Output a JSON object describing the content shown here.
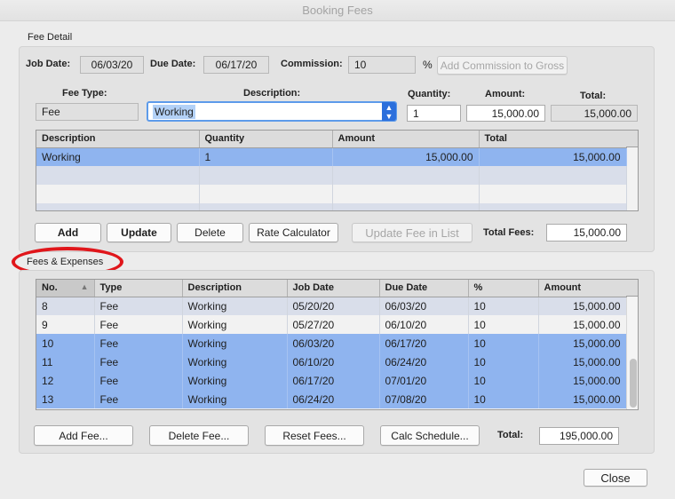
{
  "window": {
    "title": "Booking Fees"
  },
  "fee_detail": {
    "section_label": "Fee Detail",
    "job_date": {
      "label": "Job Date:",
      "value": "06/03/20"
    },
    "due_date": {
      "label": "Due Date:",
      "value": "06/17/20"
    },
    "commission": {
      "label": "Commission:",
      "value": "10",
      "unit": "%"
    },
    "add_commission_button": "Add Commission to Gross",
    "fee_type": {
      "label": "Fee Type:",
      "value": "Fee"
    },
    "description": {
      "label": "Description:",
      "value": "Working"
    },
    "quantity": {
      "label": "Quantity:",
      "value": "1"
    },
    "amount": {
      "label": "Amount:",
      "value": "15,000.00"
    },
    "total": {
      "label": "Total:",
      "value": "15,000.00"
    },
    "table": {
      "columns": [
        "Description",
        "Quantity",
        "Amount",
        "Total"
      ],
      "rows": [
        [
          "Working",
          "1",
          "15,000.00",
          "15,000.00"
        ]
      ]
    },
    "buttons": {
      "add": "Add",
      "update": "Update",
      "delete": "Delete",
      "rate_calculator": "Rate Calculator",
      "update_fee_in_list": "Update Fee in List"
    },
    "total_fees": {
      "label": "Total Fees:",
      "value": "15,000.00"
    }
  },
  "fees_expenses": {
    "section_label": "Fees & Expenses",
    "table": {
      "columns": [
        "No.",
        "Type",
        "Description",
        "Job Date",
        "Due Date",
        "%",
        "Amount"
      ],
      "sort_indicator": "▲",
      "rows": [
        [
          "8",
          "Fee",
          "Working",
          "05/20/20",
          "06/03/20",
          "10",
          "15,000.00"
        ],
        [
          "9",
          "Fee",
          "Working",
          "05/27/20",
          "06/10/20",
          "10",
          "15,000.00"
        ],
        [
          "10",
          "Fee",
          "Working",
          "06/03/20",
          "06/17/20",
          "10",
          "15,000.00"
        ],
        [
          "11",
          "Fee",
          "Working",
          "06/10/20",
          "06/24/20",
          "10",
          "15,000.00"
        ],
        [
          "12",
          "Fee",
          "Working",
          "06/17/20",
          "07/01/20",
          "10",
          "15,000.00"
        ],
        [
          "13",
          "Fee",
          "Working",
          "06/24/20",
          "07/08/20",
          "10",
          "15,000.00"
        ]
      ]
    },
    "buttons": {
      "add_fee": "Add Fee...",
      "delete_fee": "Delete Fee...",
      "reset_fees": "Reset Fees...",
      "calc_schedule": "Calc Schedule..."
    },
    "total": {
      "label": "Total:",
      "value": "195,000.00"
    }
  },
  "close_button": "Close",
  "colors": {
    "selection": "#8fb4ef",
    "annotation": "#e0161b",
    "accent": "#2b6fdc"
  }
}
